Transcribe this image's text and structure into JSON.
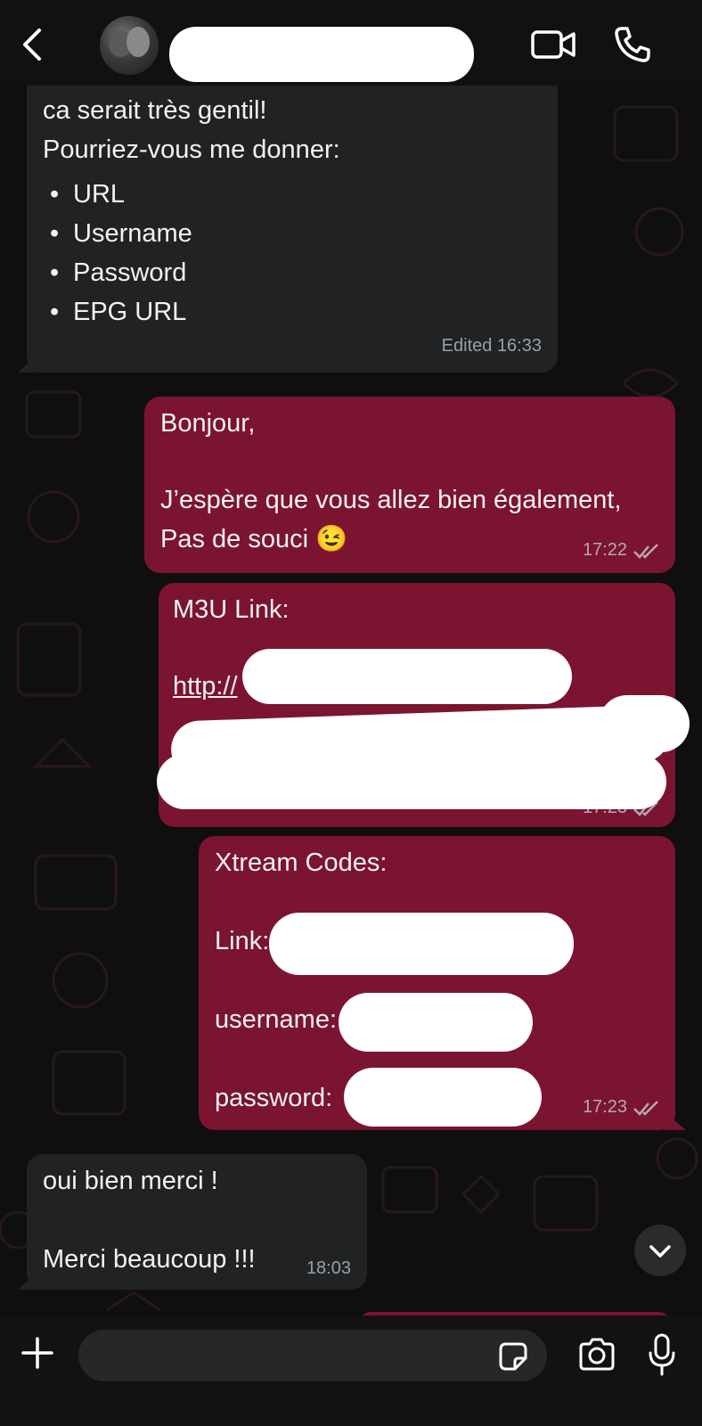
{
  "header": {
    "contact_name": ""
  },
  "messages": {
    "m1": {
      "lines": [
        "ca serait très gentil!",
        "Pourriez-vous me donner:"
      ],
      "bullets": [
        "URL",
        "Username",
        "Password",
        "EPG URL"
      ],
      "time": "Edited 16:33"
    },
    "m2": {
      "line1": "Bonjour,",
      "line2": "J’espère que vous allez bien également,",
      "line3": "Pas de souci 😉",
      "time": "17:22"
    },
    "m3": {
      "title": "M3U Link:",
      "link_prefix": "http://",
      "time": "17:23"
    },
    "m4": {
      "title": "Xtream Codes:",
      "link_label": "Link:",
      "username_label": "username:",
      "password_label": "password:",
      "time": "17:23"
    },
    "m5": {
      "line1": "oui bien merci !",
      "line2": "Merci beaucoup !!!",
      "time": "18:03"
    }
  },
  "composer": {
    "placeholder": ""
  },
  "colors": {
    "outgoing_bubble": "#7b1430",
    "incoming_bubble": "#202223",
    "background": "#0f0f10"
  }
}
